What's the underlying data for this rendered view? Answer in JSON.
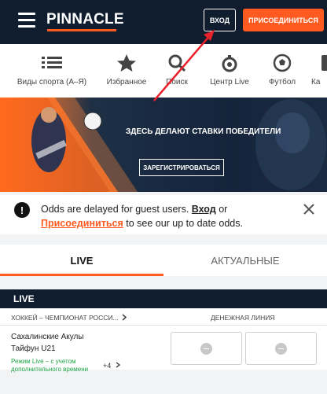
{
  "header": {
    "logo": "PINNACLE",
    "login_label": "ВХОД",
    "join_label": "ПРИСОЕДИНИТЬСЯ"
  },
  "categories": [
    {
      "label": "Виды спорта (А–Я)",
      "icon": "list-icon"
    },
    {
      "label": "Избранное",
      "icon": "star-icon"
    },
    {
      "label": "Поиск",
      "icon": "search-icon"
    },
    {
      "label": "Центр Live",
      "icon": "stopwatch-icon"
    },
    {
      "label": "Футбол",
      "icon": "soccer-ball-icon"
    },
    {
      "label": "Ка",
      "icon": "partial-icon"
    }
  ],
  "banner": {
    "headline": "ЗДЕСЬ ДЕЛАЮТ СТАВКИ ПОБЕДИТЕЛИ",
    "register_label": "ЗАРЕГИСТРИРОВАТЬСЯ"
  },
  "notice": {
    "text_1": "Odds are delayed for guest users.",
    "login_link": "Вход",
    "text_2": "or",
    "join_link": "Присоединиться",
    "text_3": "to see our up to date odds."
  },
  "tabs": {
    "live": "LIVE",
    "actual": "АКТУАЛЬНЫЕ"
  },
  "live_section": {
    "title": "LIVE",
    "league": "ХОККЕЙ – ЧЕМПИОНАТ РОССИ...",
    "market": "ДЕНЕЖНАЯ ЛИНИЯ",
    "match": {
      "team1": "Сахалинские Акулы",
      "team2": "Тайфун U21",
      "mode": "Режим Live – с учетом дополнительного времени",
      "more": "+4"
    }
  },
  "colors": {
    "accent": "#ff5a1f",
    "header_bg": "#0f1d2e",
    "live_green": "#1ea446"
  }
}
